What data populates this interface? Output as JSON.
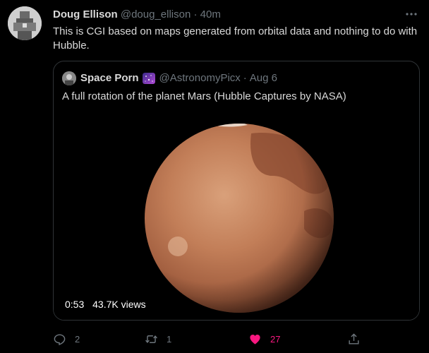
{
  "tweet": {
    "author_name": "Doug Ellison",
    "handle": "@doug_ellison",
    "separator": "·",
    "time": "40m",
    "text": "This is CGI based on maps generated from orbital data and nothing to do with Hubble."
  },
  "quote": {
    "author_name": "Space Porn",
    "handle": "@AstronomyPicx",
    "separator": "·",
    "time": "Aug 6",
    "text": "A full rotation of the planet Mars (Hubble Captures by NASA)",
    "video": {
      "duration": "0:53",
      "views": "43.7K views"
    }
  },
  "actions": {
    "reply_count": "2",
    "retweet_count": "1",
    "like_count": "27"
  },
  "colors": {
    "background": "#000000",
    "text": "#d9d9d9",
    "muted": "#6e767d",
    "border": "#2f3336",
    "like": "#f91880"
  },
  "icons": [
    "avatar",
    "more-icon",
    "galaxy-emoji",
    "reply-icon",
    "retweet-icon",
    "heart-icon",
    "share-icon"
  ]
}
